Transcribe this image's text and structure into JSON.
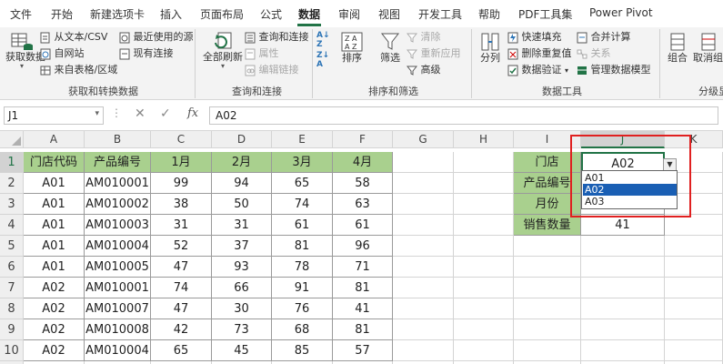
{
  "tabs": [
    "文件",
    "开始",
    "新建选项卡",
    "插入",
    "页面布局",
    "公式",
    "数据",
    "审阅",
    "视图",
    "开发工具",
    "帮助",
    "PDF工具集",
    "Power Pivot"
  ],
  "active_tab": "数据",
  "ribbon": {
    "get_data": "获取数据",
    "from_text_csv": "从文本/CSV",
    "from_web": "自网站",
    "from_table": "来自表格/区域",
    "recent_sources": "最近使用的源",
    "existing_connections": "现有连接",
    "group_get_transform": "获取和转换数据",
    "refresh_all": "全部刷新",
    "queries_connections": "查询和连接",
    "properties": "属性",
    "edit_links": "编辑链接",
    "group_queries": "查询和连接",
    "sort": "排序",
    "filter": "筛选",
    "clear": "清除",
    "reapply": "重新应用",
    "advanced": "高级",
    "group_sort_filter": "排序和筛选",
    "text_to_columns": "分列",
    "flash_fill": "快速填充",
    "remove_duplicates": "删除重复值",
    "data_validation": "数据验证",
    "consolidate": "合并计算",
    "relationships": "关系",
    "manage_data_model": "管理数据模型",
    "group_data_tools": "数据工具",
    "group_btn": "组合",
    "ungroup_btn": "取消组合",
    "group_outline": "分级显"
  },
  "formula_bar": {
    "name_box": "J1",
    "fx": "fx",
    "value": "A02"
  },
  "columns": [
    "A",
    "B",
    "C",
    "D",
    "E",
    "F",
    "G",
    "H",
    "I",
    "J",
    "K"
  ],
  "selected_column": "J",
  "rows": [
    "1",
    "2",
    "3",
    "4",
    "5",
    "6",
    "7",
    "8",
    "9",
    "10"
  ],
  "selected_row": "1",
  "table": {
    "headers": [
      "门店代码",
      "产品编号",
      "1月",
      "2月",
      "3月",
      "4月"
    ],
    "rows": [
      [
        "A01",
        "AM010001",
        "99",
        "94",
        "65",
        "58"
      ],
      [
        "A01",
        "AM010002",
        "38",
        "50",
        "74",
        "63"
      ],
      [
        "A01",
        "AM010003",
        "31",
        "31",
        "61",
        "61"
      ],
      [
        "A01",
        "AM010004",
        "52",
        "37",
        "81",
        "96"
      ],
      [
        "A01",
        "AM010005",
        "47",
        "93",
        "78",
        "71"
      ],
      [
        "A02",
        "AM010001",
        "74",
        "66",
        "91",
        "81"
      ],
      [
        "A02",
        "AM010007",
        "47",
        "30",
        "76",
        "41"
      ],
      [
        "A02",
        "AM010008",
        "42",
        "73",
        "68",
        "81"
      ],
      [
        "A02",
        "AM010004",
        "65",
        "45",
        "85",
        "57"
      ]
    ]
  },
  "lookup": {
    "labels": [
      "门店",
      "产品编号",
      "月份",
      "销售数量"
    ],
    "values": [
      "A02",
      "",
      "",
      "41"
    ]
  },
  "dropdown": {
    "options": [
      "A01",
      "A02",
      "A03"
    ],
    "selected": "A02"
  },
  "colors": {
    "accent": "#217346",
    "header_fill": "#a9d08e",
    "highlight_box": "#e02020",
    "selected_option": "#1a5fb4"
  }
}
